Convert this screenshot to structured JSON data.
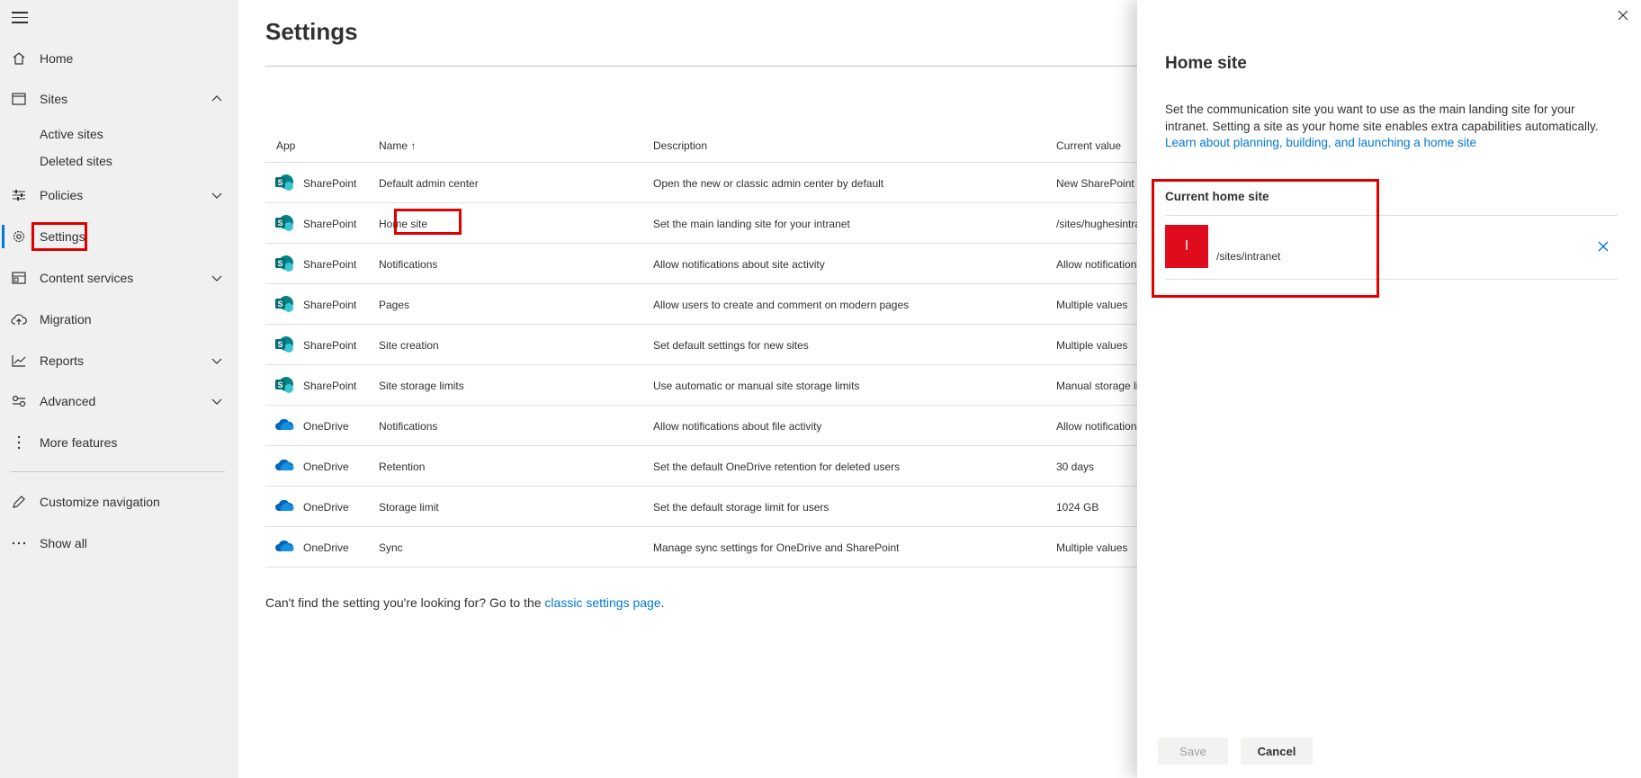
{
  "nav": {
    "home": "Home",
    "sites": "Sites",
    "active_sites": "Active sites",
    "deleted_sites": "Deleted sites",
    "policies": "Policies",
    "settings": "Settings",
    "content_services": "Content services",
    "migration": "Migration",
    "reports": "Reports",
    "advanced": "Advanced",
    "more_features": "More features",
    "customize_navigation": "Customize navigation",
    "show_all": "Show all"
  },
  "main": {
    "title": "Settings",
    "columns": {
      "app": "App",
      "name": "Name ↑",
      "description": "Description",
      "current_value": "Current value"
    },
    "rows": [
      {
        "app": "SharePoint",
        "name": "Default admin center",
        "description": "Open the new or classic admin center by default",
        "current": "New SharePoint admin center"
      },
      {
        "app": "SharePoint",
        "name": "Home site",
        "description": "Set the main landing site for your intranet",
        "current": "/sites/hughesintranet"
      },
      {
        "app": "SharePoint",
        "name": "Notifications",
        "description": "Allow notifications about site activity",
        "current": "Allow notifications"
      },
      {
        "app": "SharePoint",
        "name": "Pages",
        "description": "Allow users to create and comment on modern pages",
        "current": "Multiple values"
      },
      {
        "app": "SharePoint",
        "name": "Site creation",
        "description": "Set default settings for new sites",
        "current": "Multiple values"
      },
      {
        "app": "SharePoint",
        "name": "Site storage limits",
        "description": "Use automatic or manual site storage limits",
        "current": "Manual storage limits"
      },
      {
        "app": "OneDrive",
        "name": "Notifications",
        "description": "Allow notifications about file activity",
        "current": "Allow notifications"
      },
      {
        "app": "OneDrive",
        "name": "Retention",
        "description": "Set the default OneDrive retention for deleted users",
        "current": "30 days"
      },
      {
        "app": "OneDrive",
        "name": "Storage limit",
        "description": "Set the default storage limit for users",
        "current": "1024 GB"
      },
      {
        "app": "OneDrive",
        "name": "Sync",
        "description": "Manage sync settings for OneDrive and SharePoint",
        "current": "Multiple values"
      }
    ],
    "footer_text": "Can't find the setting you're looking for? Go to the ",
    "footer_link": "classic settings page",
    "footer_end": "."
  },
  "panel": {
    "title": "Home site",
    "description": "Set the communication site you want to use as the main landing site for your intranet. Setting a site as your home site enables extra capabilities automatically.",
    "learn_link": "Learn about planning, building, and launching a home site",
    "current_title": "Current home site",
    "site_initial": "I",
    "site_path": "/sites/intranet",
    "save_label": "Save",
    "cancel_label": "Cancel"
  },
  "colors": {
    "accent": "#0078d4",
    "highlight": "#e00000",
    "sharepoint": "#038387",
    "onedrive": "#0364b8",
    "site_thumb": "#e00b1c"
  }
}
